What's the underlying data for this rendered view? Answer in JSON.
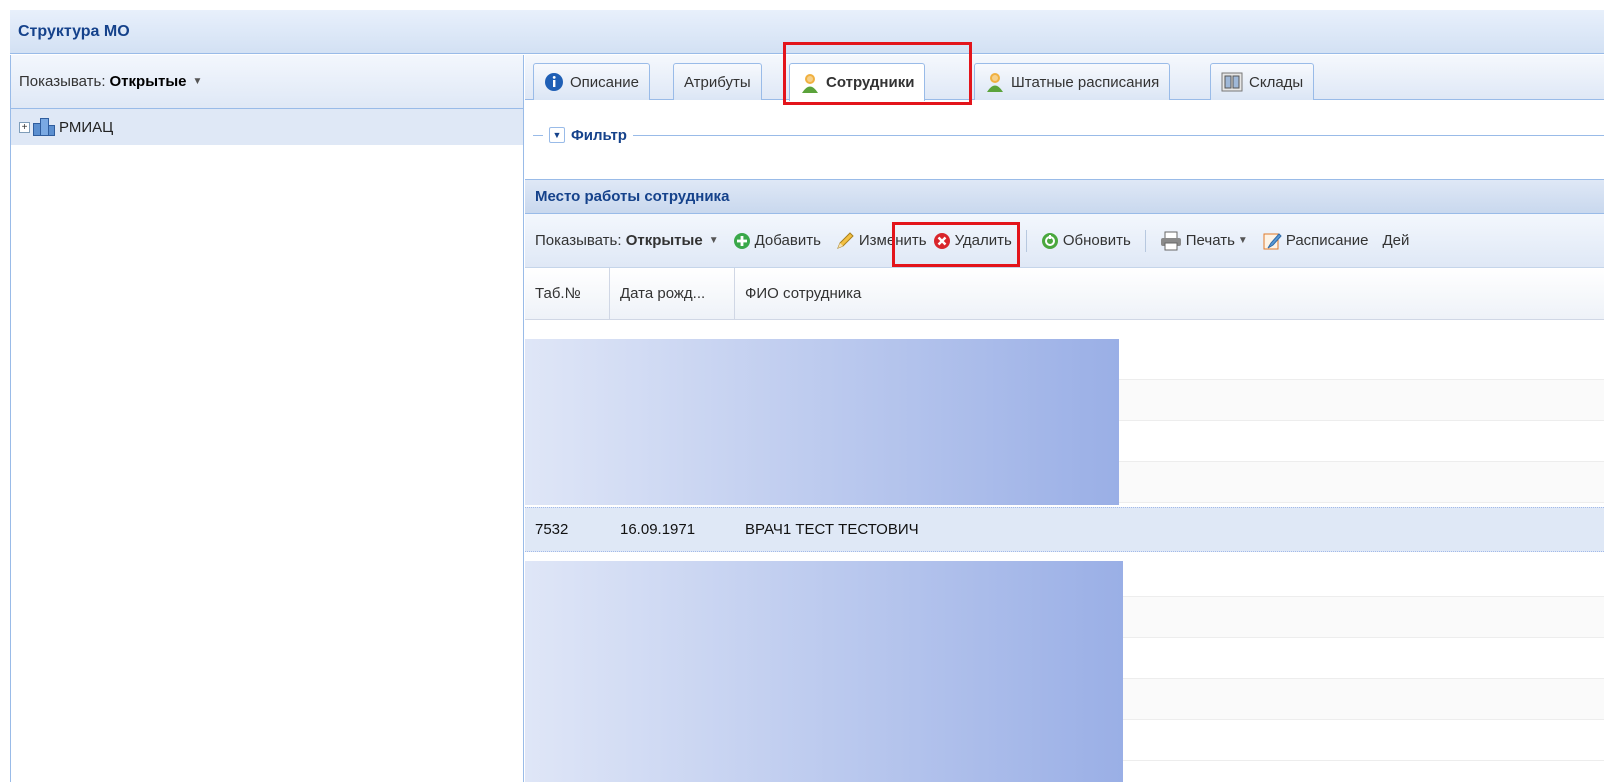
{
  "app": {
    "title": "Структура МО"
  },
  "left": {
    "show_label": "Показывать:",
    "show_value": "Открытые",
    "tree": [
      {
        "label": "РМИАЦ"
      }
    ]
  },
  "tabs": [
    {
      "label": "Описание",
      "icon": "info-icon"
    },
    {
      "label": "Атрибуты",
      "icon": ""
    },
    {
      "label": "Сотрудники",
      "icon": "employee-icon",
      "active": true
    },
    {
      "label": "Штатные расписания",
      "icon": "employee-icon"
    },
    {
      "label": "Склады",
      "icon": "warehouse-icon"
    }
  ],
  "filter": {
    "label": "Фильтр"
  },
  "section": {
    "title": "Место работы сотрудника"
  },
  "toolbar": {
    "show_label": "Показывать:",
    "show_value": "Открытые",
    "add": "Добавить",
    "edit": "Изменить",
    "delete": "Удалить",
    "refresh": "Обновить",
    "print": "Печать",
    "schedule": "Расписание",
    "actions": "Дей"
  },
  "grid": {
    "columns": [
      "Таб.№",
      "Дата рожд...",
      "ФИО сотрудника"
    ],
    "rows": [
      {
        "tab_no": "7532",
        "birth_date": "16.09.1971",
        "name": "ВРАЧ1 ТЕСТ ТЕСТОВИЧ"
      }
    ]
  },
  "colors": {
    "highlight": "#e3141b",
    "header_text": "#15428b",
    "selected_row": "#dfe8f6"
  }
}
